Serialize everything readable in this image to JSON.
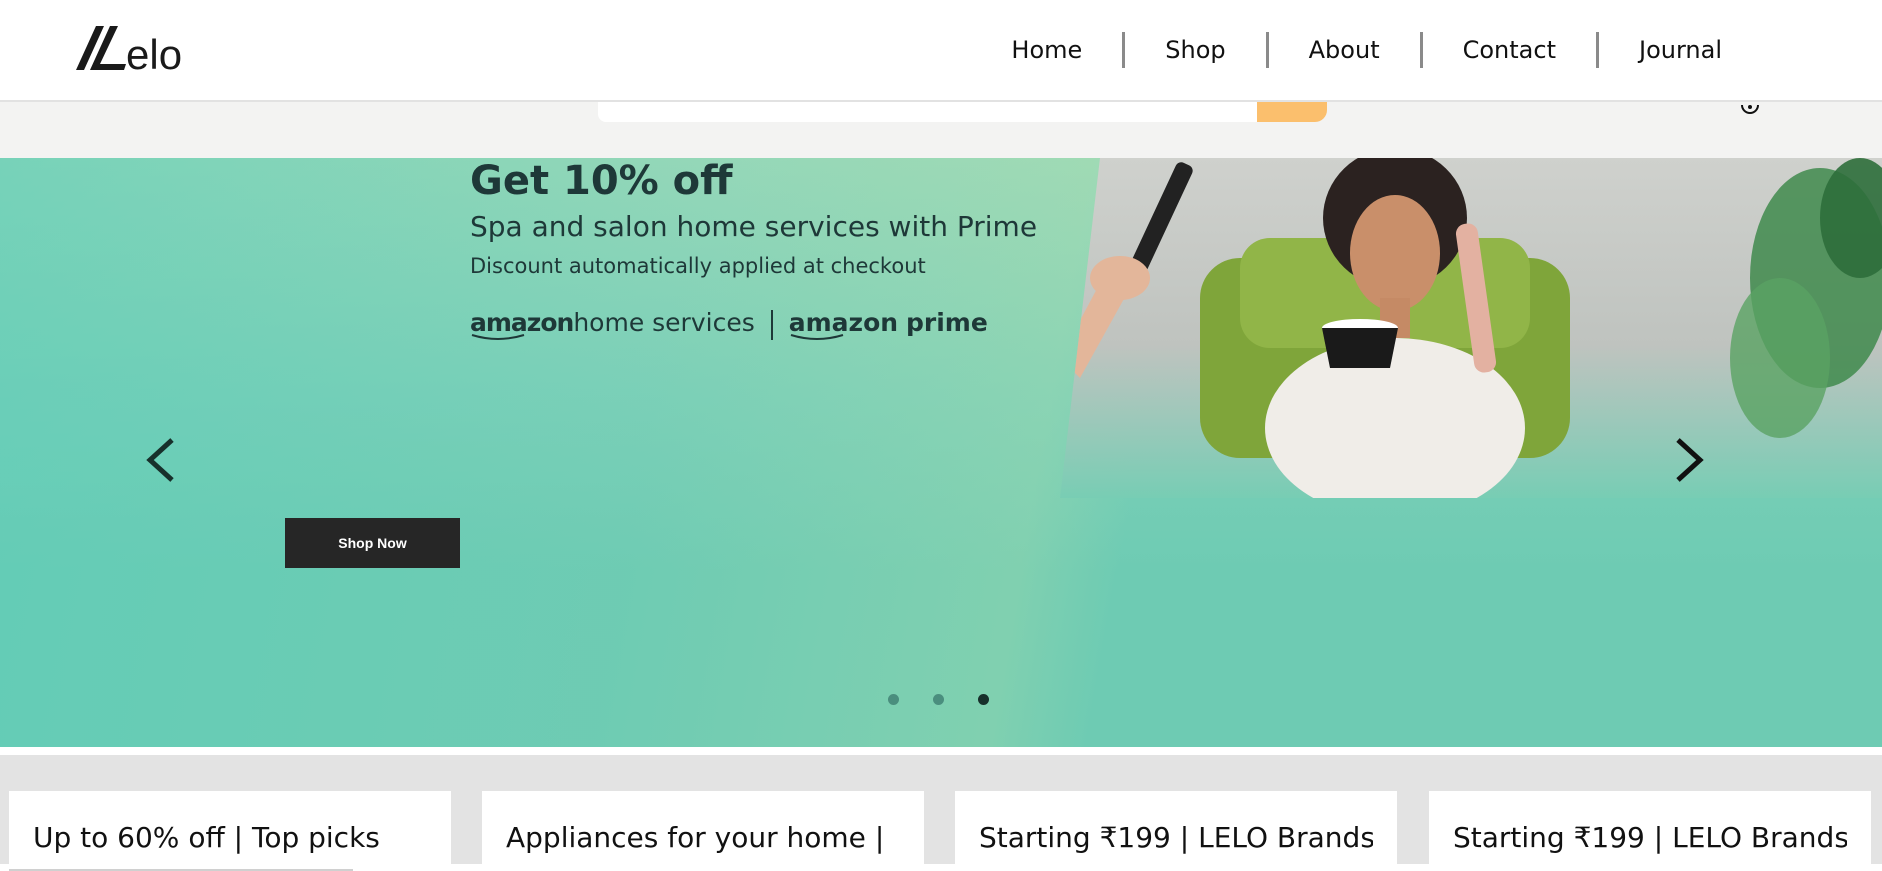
{
  "header": {
    "logo_text": "Lelo",
    "nav": [
      {
        "label": "Home"
      },
      {
        "label": "Shop"
      },
      {
        "label": "About"
      },
      {
        "label": "Contact"
      },
      {
        "label": "Journal"
      }
    ]
  },
  "search": {
    "placeholder": "",
    "button_color": "#fbbf6d"
  },
  "hero": {
    "title": "Get 10% off",
    "subtitle": "Spa and salon home services with Prime",
    "note": "Discount automatically applied at checkout",
    "brand_left_bold": "amazon",
    "brand_left_rest": "home services",
    "brand_right_bold_a": "amazon",
    "brand_right_bold_b": "prime",
    "shop_button": "Shop Now",
    "background_color": "#6ecbb3",
    "slides": 3,
    "active_slide": 3
  },
  "cards": [
    {
      "title": "Up to 60% off | Top picks"
    },
    {
      "title": "Appliances for your home |"
    },
    {
      "title": "Starting ₹199 | LELO Brands"
    },
    {
      "title": "Starting ₹199 | LELO Brands"
    }
  ],
  "icons": [
    "logo-icon",
    "search-icon",
    "account-icon",
    "chevron-left-icon",
    "chevron-right-icon"
  ]
}
